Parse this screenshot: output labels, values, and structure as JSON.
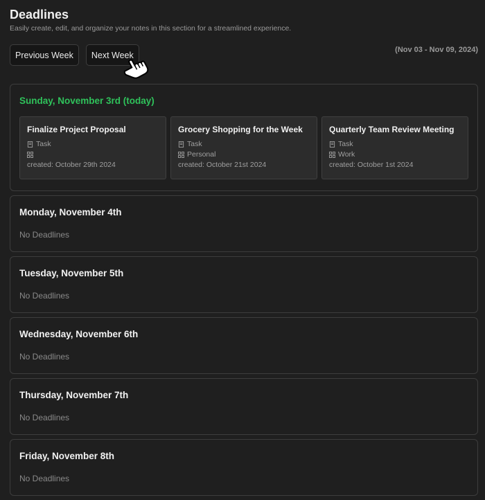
{
  "page": {
    "title": "Deadlines",
    "subtitle": "Easily create, edit, and organize your notes in this section for a streamlined experience."
  },
  "controls": {
    "prev_label": "Previous Week",
    "next_label": "Next Week",
    "range": "(Nov 03 - Nov 09, 2024)"
  },
  "today": {
    "title": "Sunday, November 3rd (today)",
    "cards": [
      {
        "title": "Finalize Project Proposal",
        "type": "Task",
        "category": "",
        "created": "created: October 29th 2024"
      },
      {
        "title": "Grocery Shopping for the Week",
        "type": "Task",
        "category": "Personal",
        "created": "created: October 21st 2024"
      },
      {
        "title": "Quarterly Team Review Meeting",
        "type": "Task",
        "category": "Work",
        "created": "created: October 1st 2024"
      }
    ]
  },
  "days": [
    {
      "title": "Monday, November 4th",
      "empty_text": "No Deadlines"
    },
    {
      "title": "Tuesday, November 5th",
      "empty_text": "No Deadlines"
    },
    {
      "title": "Wednesday, November 6th",
      "empty_text": "No Deadlines"
    },
    {
      "title": "Thursday, November 7th",
      "empty_text": "No Deadlines"
    },
    {
      "title": "Friday, November 8th",
      "empty_text": "No Deadlines"
    }
  ],
  "colors": {
    "background": "#1f1f1f",
    "today_accent": "#2fc25b",
    "card_bg": "#2c2c2c"
  },
  "icons": {
    "type": "note-icon",
    "category": "category-grid-icon",
    "cursor": "pointer-hand-icon"
  }
}
